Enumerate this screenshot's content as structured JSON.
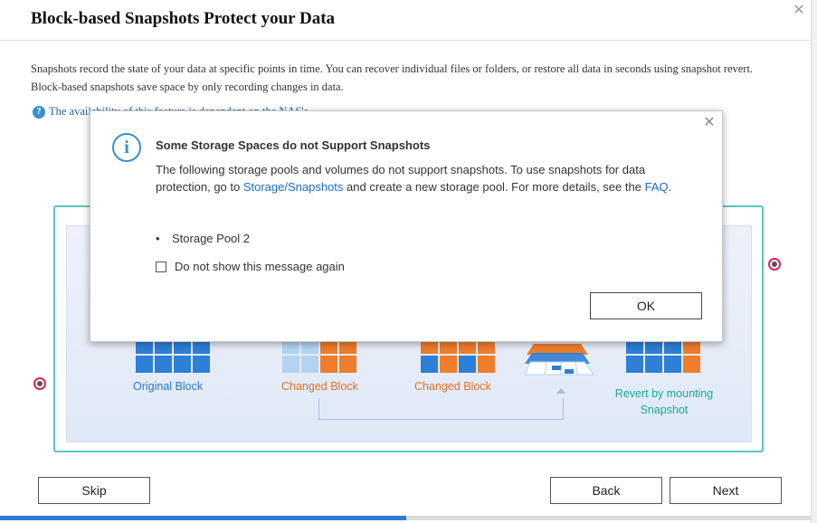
{
  "wizard": {
    "title": "Block-based Snapshots Protect your Data",
    "close_glyph": "✕",
    "description": "Snapshots record the state of your data at specific points in time. You can recover individual files or folders, or restore all data in seconds using snapshot revert. Block-based snapshots save space by only recording changes in data.",
    "note_text": "The availability of this feature is dependent on the NAS's"
  },
  "illustration": {
    "original_block_label": "Original Block",
    "changed_block_label_1": "Changed Block",
    "changed_block_label_2": "Changed Block",
    "revert_label": "Revert by mounting Snapshot"
  },
  "footer": {
    "skip_label": "Skip",
    "back_label": "Back",
    "next_label": "Next",
    "progress_fraction": 0.5
  },
  "dialog": {
    "title": "Some Storage Spaces do not Support Snapshots",
    "body_prefix": "The following storage pools and volumes do not support snapshots. To use snapshots for data protection, go to ",
    "storage_link": "Storage/Snapshots",
    "body_middle": " and create a new storage pool. For more details, see the ",
    "faq_link": "FAQ",
    "body_suffix": ".",
    "pools": [
      "Storage Pool 2"
    ],
    "checkbox_label": "Do not show this message again",
    "ok_label": "OK",
    "close_glyph": "✕",
    "info_glyph": "i"
  },
  "colors": {
    "accent": "#2d7bd1",
    "block_blue": "#2e7fd7",
    "block_orange": "#ef7d2c",
    "block_light": "#b4d3f3",
    "frame_teal": "#5cc5bd",
    "indicator_pink": "#d3245f"
  }
}
